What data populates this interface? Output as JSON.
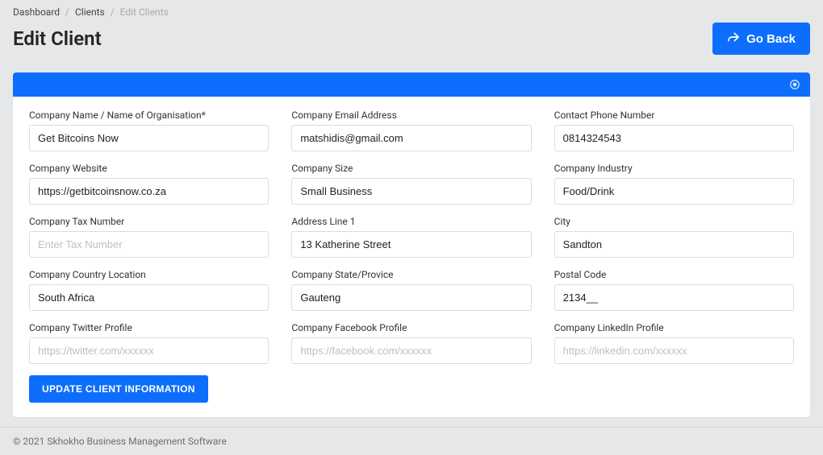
{
  "breadcrumb": {
    "items": [
      "Dashboard",
      "Clients",
      "Edit Clients"
    ]
  },
  "page_title": "Edit Client",
  "go_back_label": "Go Back",
  "form": {
    "company_name": {
      "label": "Company Name / Name of Organisation*",
      "value": "Get Bitcoins Now",
      "placeholder": ""
    },
    "company_email": {
      "label": "Company Email Address",
      "value": "matshidis@gmail.com",
      "placeholder": ""
    },
    "contact_phone": {
      "label": "Contact Phone Number",
      "value": "0814324543",
      "placeholder": ""
    },
    "company_website": {
      "label": "Company Website",
      "value": "https://getbitcoinsnow.co.za",
      "placeholder": ""
    },
    "company_size": {
      "label": "Company Size",
      "value": "Small Business",
      "placeholder": ""
    },
    "company_industry": {
      "label": "Company Industry",
      "value": "Food/Drink",
      "placeholder": ""
    },
    "tax_number": {
      "label": "Company Tax Number",
      "value": "",
      "placeholder": "Enter Tax Number"
    },
    "address_line1": {
      "label": "Address Line 1",
      "value": "13 Katherine Street",
      "placeholder": ""
    },
    "city": {
      "label": "City",
      "value": "Sandton",
      "placeholder": ""
    },
    "country": {
      "label": "Company Country Location",
      "value": "South Africa",
      "placeholder": ""
    },
    "state": {
      "label": "Company State/Provice",
      "value": "Gauteng",
      "placeholder": ""
    },
    "postal_code": {
      "label": "Postal Code",
      "value": "2134__",
      "placeholder": ""
    },
    "twitter": {
      "label": "Company Twitter Profile",
      "value": "",
      "placeholder": "https://twitter.com/xxxxxx"
    },
    "facebook": {
      "label": "Company Facebook Profile",
      "value": "",
      "placeholder": "https://facebook.com/xxxxxx"
    },
    "linkedin": {
      "label": "Company LinkedIn Profile",
      "value": "",
      "placeholder": "https://linkedin.com/xxxxxx"
    }
  },
  "submit_label": "UPDATE CLIENT INFORMATION",
  "footer_text": "© 2021 Skhokho Business Management Software"
}
